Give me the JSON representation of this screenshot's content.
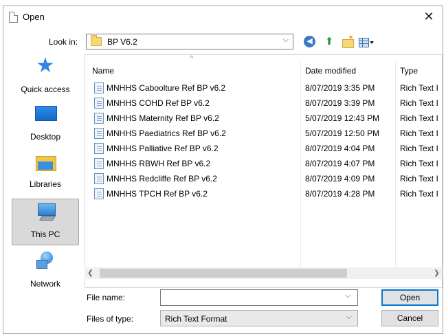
{
  "dialog": {
    "title": "Open",
    "look_in_label": "Look in:",
    "look_in_value": "BP V6.2"
  },
  "places": [
    {
      "label": "Quick access",
      "icon": "star-icon",
      "selected": false
    },
    {
      "label": "Desktop",
      "icon": "desktop-icon",
      "selected": false
    },
    {
      "label": "Libraries",
      "icon": "libraries-icon",
      "selected": false
    },
    {
      "label": "This PC",
      "icon": "this-pc-icon",
      "selected": true
    },
    {
      "label": "Network",
      "icon": "network-icon",
      "selected": false
    }
  ],
  "columns": {
    "name": "Name",
    "date": "Date modified",
    "type": "Type"
  },
  "files": [
    {
      "name": "MNHHS Caboolture Ref BP v6.2",
      "date": "8/07/2019 3:35 PM",
      "type": "Rich Text I"
    },
    {
      "name": "MNHHS COHD Ref BP v6.2",
      "date": "8/07/2019 3:39 PM",
      "type": "Rich Text I"
    },
    {
      "name": "MNHHS Maternity Ref BP v6.2",
      "date": "5/07/2019 12:43 PM",
      "type": "Rich Text I"
    },
    {
      "name": "MNHHS Paediatrics Ref BP v6.2",
      "date": "5/07/2019 12:50 PM",
      "type": "Rich Text I"
    },
    {
      "name": "MNHHS Palliative Ref BP v6.2",
      "date": "8/07/2019 4:04 PM",
      "type": "Rich Text I"
    },
    {
      "name": "MNHHS RBWH Ref BP v6.2",
      "date": "8/07/2019 4:07 PM",
      "type": "Rich Text I"
    },
    {
      "name": "MNHHS Redcliffe Ref BP v6.2",
      "date": "8/07/2019 4:09 PM",
      "type": "Rich Text I"
    },
    {
      "name": "MNHHS TPCH Ref BP v6.2",
      "date": "8/07/2019 4:28 PM",
      "type": "Rich Text I"
    }
  ],
  "footer": {
    "file_name_label": "File name:",
    "file_name_value": "",
    "file_type_label": "Files of type:",
    "file_type_value": "Rich Text Format",
    "open_label": "Open",
    "cancel_label": "Cancel"
  },
  "colors": {
    "accent": "#0078d7",
    "selected_place_bg": "#d9d9d9"
  }
}
